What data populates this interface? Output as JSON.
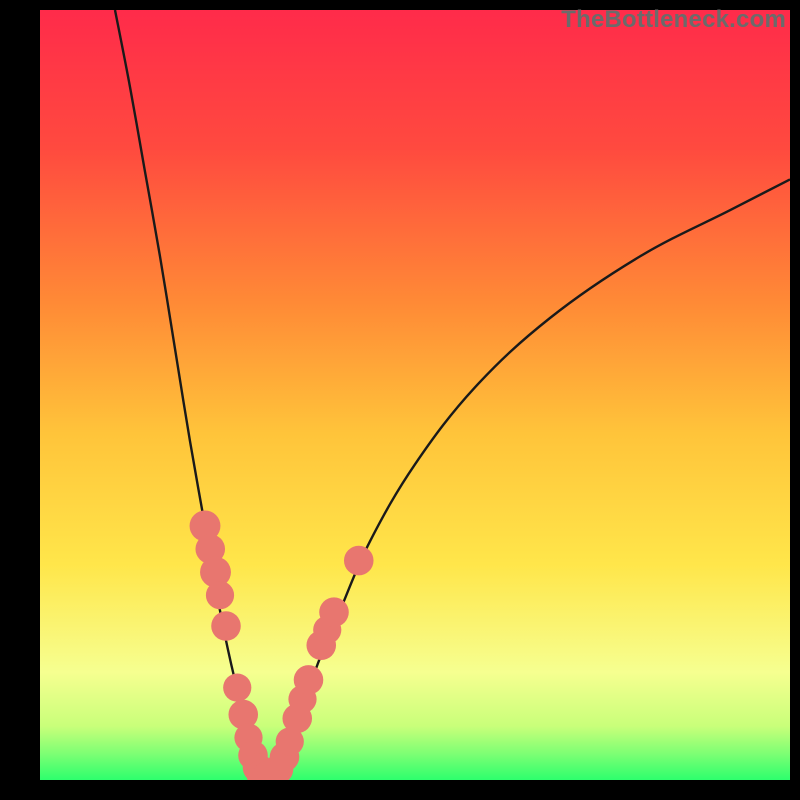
{
  "watermark": "TheBottleneck.com",
  "colors": {
    "background": "#000000",
    "gradient_stops": [
      {
        "offset": 0.0,
        "color": "#ff2b4a"
      },
      {
        "offset": 0.18,
        "color": "#ff4a3f"
      },
      {
        "offset": 0.38,
        "color": "#ff8a36"
      },
      {
        "offset": 0.55,
        "color": "#ffc43a"
      },
      {
        "offset": 0.72,
        "color": "#ffe64a"
      },
      {
        "offset": 0.86,
        "color": "#f6ff90"
      },
      {
        "offset": 0.93,
        "color": "#c9ff7a"
      },
      {
        "offset": 0.965,
        "color": "#7fff74"
      },
      {
        "offset": 1.0,
        "color": "#2dff6d"
      }
    ],
    "curve": "#1a1a1a",
    "marker_fill": "#e8766f",
    "marker_stroke": "#c85b55"
  },
  "chart_data": {
    "type": "line",
    "title": "",
    "xlabel": "",
    "ylabel": "",
    "xlim": [
      0,
      100
    ],
    "ylim": [
      0,
      100
    ],
    "grid": false,
    "legend": false,
    "annotations": [],
    "series": [
      {
        "name": "bottleneck-curve-left",
        "x": [
          10,
          12,
          14,
          16,
          18,
          20,
          22,
          24,
          25.5,
          27,
          28.2,
          29,
          29.6
        ],
        "y": [
          100,
          90,
          79,
          68,
          56,
          44,
          33,
          22,
          15,
          9,
          5,
          2.2,
          0.5
        ]
      },
      {
        "name": "bottleneck-curve-right",
        "x": [
          31,
          32,
          33.5,
          35,
          37,
          40,
          44,
          50,
          58,
          68,
          80,
          92,
          100
        ],
        "y": [
          0.5,
          2,
          5,
          9,
          15,
          22,
          31,
          41,
          51,
          60,
          68,
          74,
          78
        ]
      }
    ],
    "markers": {
      "name": "highlighted-points",
      "points": [
        {
          "x": 22.0,
          "y": 33.0,
          "r": 1.4
        },
        {
          "x": 22.7,
          "y": 30.0,
          "r": 1.3
        },
        {
          "x": 23.4,
          "y": 27.0,
          "r": 1.4
        },
        {
          "x": 24.0,
          "y": 24.0,
          "r": 1.2
        },
        {
          "x": 24.8,
          "y": 20.0,
          "r": 1.3
        },
        {
          "x": 26.3,
          "y": 12.0,
          "r": 1.2
        },
        {
          "x": 27.1,
          "y": 8.5,
          "r": 1.3
        },
        {
          "x": 27.8,
          "y": 5.5,
          "r": 1.2
        },
        {
          "x": 28.4,
          "y": 3.2,
          "r": 1.3
        },
        {
          "x": 29.0,
          "y": 1.6,
          "r": 1.3
        },
        {
          "x": 29.6,
          "y": 0.7,
          "r": 1.4
        },
        {
          "x": 30.3,
          "y": 0.4,
          "r": 1.4
        },
        {
          "x": 31.0,
          "y": 0.5,
          "r": 1.4
        },
        {
          "x": 31.8,
          "y": 1.4,
          "r": 1.3
        },
        {
          "x": 32.6,
          "y": 3.0,
          "r": 1.3
        },
        {
          "x": 33.3,
          "y": 5.0,
          "r": 1.2
        },
        {
          "x": 34.3,
          "y": 8.0,
          "r": 1.3
        },
        {
          "x": 35.0,
          "y": 10.5,
          "r": 1.2
        },
        {
          "x": 35.8,
          "y": 13.0,
          "r": 1.3
        },
        {
          "x": 37.5,
          "y": 17.5,
          "r": 1.3
        },
        {
          "x": 38.3,
          "y": 19.5,
          "r": 1.2
        },
        {
          "x": 39.2,
          "y": 21.8,
          "r": 1.3
        },
        {
          "x": 42.5,
          "y": 28.5,
          "r": 1.3
        }
      ]
    }
  }
}
